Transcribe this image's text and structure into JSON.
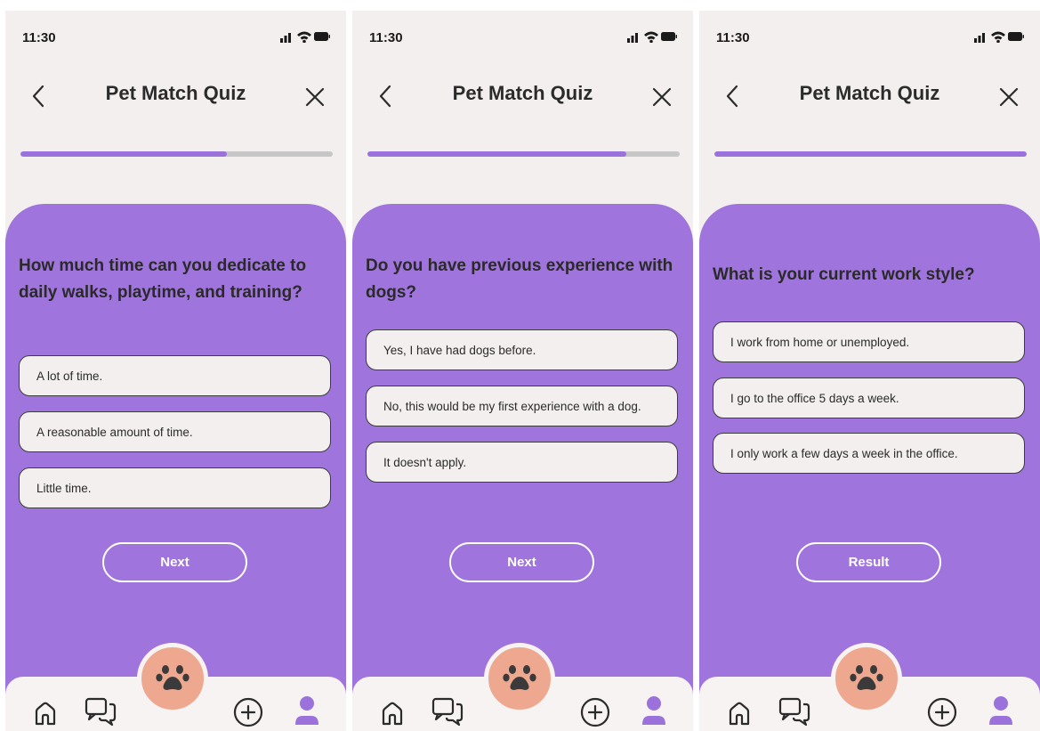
{
  "colors": {
    "accent_purple": "#a074dd",
    "progress_fill": "#9b72db",
    "progress_track": "#c7c7c7",
    "paw_button": "#efa890",
    "background": "#f3efee"
  },
  "screens": [
    {
      "status_time": "11:30",
      "title": "Pet Match Quiz",
      "progress": 0.66,
      "question": "How much time can you dedicate to daily walks, playtime, and training?",
      "options": [
        "A lot of time.",
        "A reasonable amount of time.",
        "Little time."
      ],
      "button_label": "Next"
    },
    {
      "status_time": "11:30",
      "title": "Pet Match Quiz",
      "progress": 0.83,
      "question": "Do you have previous experience with dogs?",
      "options": [
        "Yes, I have had dogs before.",
        "No, this would be my first experience with a dog.",
        "It doesn't apply."
      ],
      "button_label": "Next"
    },
    {
      "status_time": "11:30",
      "title": "Pet Match Quiz",
      "progress": 1.0,
      "question": "What is your current work style?",
      "options": [
        "I work from home or unemployed.",
        "I go to the office 5 days a week.",
        "I only work a few days a week in the office."
      ],
      "button_label": "Result"
    }
  ],
  "icons": {
    "status": [
      "signal-icon",
      "wifi-icon",
      "battery-icon"
    ],
    "header": [
      "back-arrow-icon",
      "close-icon"
    ],
    "tabbar": [
      "home-icon",
      "chat-icon",
      "paw-icon",
      "add-icon",
      "profile-icon"
    ]
  }
}
